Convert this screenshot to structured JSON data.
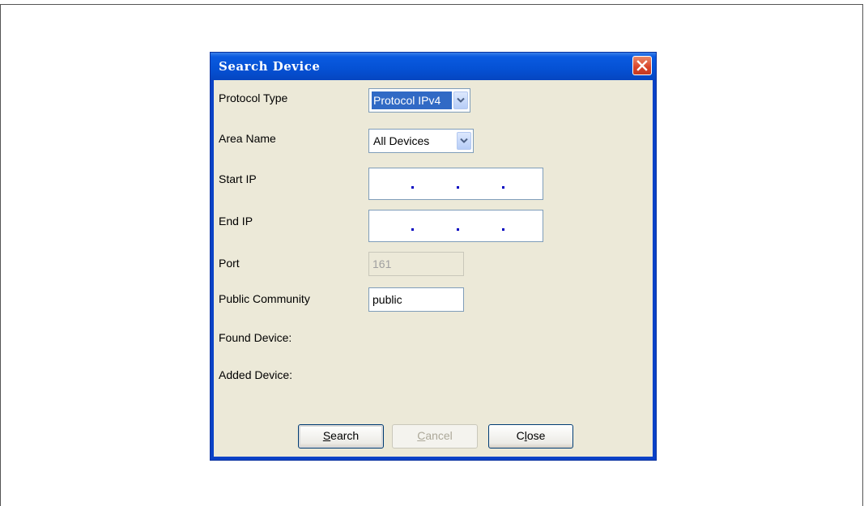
{
  "dialog": {
    "title": "Search Device",
    "close_icon": "close-x-icon"
  },
  "form": {
    "protocol_type": {
      "label": "Protocol Type",
      "value": "Protocol IPv4"
    },
    "area_name": {
      "label": "Area Name",
      "value": "All Devices"
    },
    "start_ip": {
      "label": "Start IP",
      "value": ""
    },
    "end_ip": {
      "label": "End IP",
      "value": ""
    },
    "port": {
      "label": "Port",
      "value": "161",
      "disabled": true
    },
    "public_community": {
      "label": "Public Community",
      "value": "public"
    },
    "found_device": {
      "label": "Found Device:"
    },
    "added_device": {
      "label": "Added Device:"
    }
  },
  "buttons": {
    "search": {
      "mnemonic": "S",
      "rest": "earch"
    },
    "cancel": {
      "mnemonic": "C",
      "rest": "ancel",
      "disabled": true
    },
    "close": {
      "pre": "C",
      "mnemonic": "l",
      "rest": "ose"
    }
  },
  "colors": {
    "titlebar": "#0551d4",
    "client_bg": "#ece9d8",
    "selection": "#316ac5",
    "close_button": "#d9432a"
  }
}
